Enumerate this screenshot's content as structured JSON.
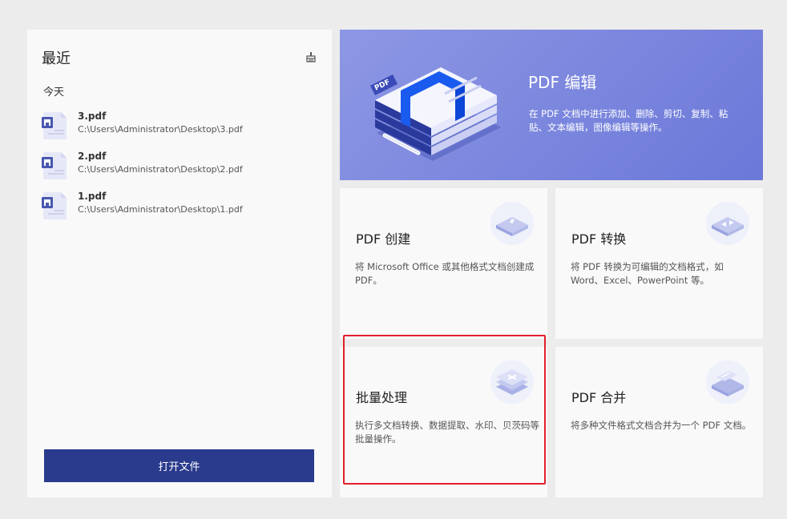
{
  "recent": {
    "title": "最近",
    "today_label": "今天",
    "files": [
      {
        "name": "3.pdf",
        "path": "C:\\Users\\Administrator\\Desktop\\3.pdf"
      },
      {
        "name": "2.pdf",
        "path": "C:\\Users\\Administrator\\Desktop\\2.pdf"
      },
      {
        "name": "1.pdf",
        "path": "C:\\Users\\Administrator\\Desktop\\1.pdf"
      }
    ],
    "open_label": "打开文件"
  },
  "hero": {
    "title": "PDF 编辑",
    "description": "在 PDF 文档中进行添加、删除、剪切、复制、粘贴、文本编辑，图像编辑等操作。",
    "badge": "PDF"
  },
  "cards": [
    {
      "title": "PDF 创建",
      "description": "将 Microsoft Office 或其他格式文档创建成 PDF。"
    },
    {
      "title": "PDF 转换",
      "description": "将 PDF 转换为可编辑的文档格式，如 Word、Excel、PowerPoint 等。"
    },
    {
      "title": "批量处理",
      "description": "执行多文档转换、数据提取、水印、贝茨码等批量操作。"
    },
    {
      "title": "PDF 合并",
      "description": "将多种文件格式文档合并为一个 PDF 文档。"
    }
  ],
  "colors": {
    "accent": "#2a3a8c",
    "hero": "#7b86dd",
    "highlight": "#e0202a"
  }
}
